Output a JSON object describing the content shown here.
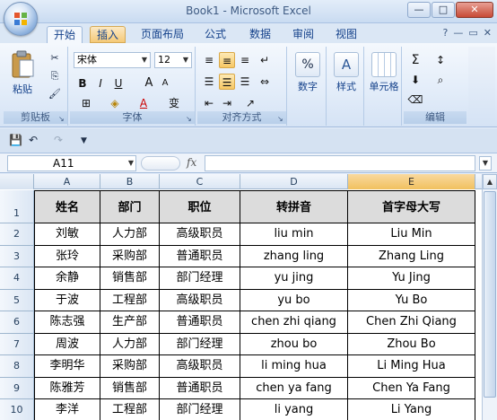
{
  "window": {
    "title": "Book1 - Microsoft Excel",
    "controls": {
      "minimize": "—",
      "maximize": "□",
      "close": "✕"
    }
  },
  "tabs": [
    "开始",
    "插入",
    "页面布局",
    "公式",
    "数据",
    "审阅",
    "视图"
  ],
  "ribbon": {
    "clipboard": {
      "label": "剪贴板",
      "paste": "粘贴"
    },
    "font": {
      "label": "字体",
      "name": "宋体",
      "size": "12",
      "bold": "B",
      "italic": "I",
      "underline": "U",
      "grow": "A",
      "shrink": "A",
      "phonetic": "变"
    },
    "alignment": {
      "label": "对齐方式"
    },
    "number": {
      "label": "数字",
      "percent": "%"
    },
    "styles": {
      "label": "样式"
    },
    "cells": {
      "label": "单元格"
    },
    "editing": {
      "label": "编辑",
      "sum": "Σ"
    }
  },
  "formula_bar": {
    "name_box": "A11",
    "fx": "fx",
    "value": ""
  },
  "columns": [
    "A",
    "B",
    "C",
    "D",
    "E"
  ],
  "selected_column": "E",
  "rows": [
    "1",
    "2",
    "3",
    "4",
    "5",
    "6",
    "7",
    "8",
    "9",
    "10"
  ],
  "table": {
    "headers": [
      "姓名",
      "部门",
      "职位",
      "转拼音",
      "首字母大写"
    ],
    "data": [
      [
        "刘敏",
        "人力部",
        "高级职员",
        "liu min",
        "Liu Min"
      ],
      [
        "张玲",
        "采购部",
        "普通职员",
        "zhang ling",
        "Zhang Ling"
      ],
      [
        "余静",
        "销售部",
        "部门经理",
        "yu jing",
        "Yu Jing"
      ],
      [
        "于波",
        "工程部",
        "高级职员",
        "yu bo",
        "Yu Bo"
      ],
      [
        "陈志强",
        "生产部",
        "普通职员",
        "chen zhi qiang",
        "Chen Zhi Qiang"
      ],
      [
        "周波",
        "人力部",
        "部门经理",
        "zhou bo",
        "Zhou Bo"
      ],
      [
        "李明华",
        "采购部",
        "高级职员",
        "li ming hua",
        "Li Ming Hua"
      ],
      [
        "陈雅芳",
        "销售部",
        "普通职员",
        "chen ya fang",
        "Chen Ya Fang"
      ],
      [
        "李洋",
        "工程部",
        "部门经理",
        "li yang",
        "Li Yang"
      ]
    ]
  }
}
